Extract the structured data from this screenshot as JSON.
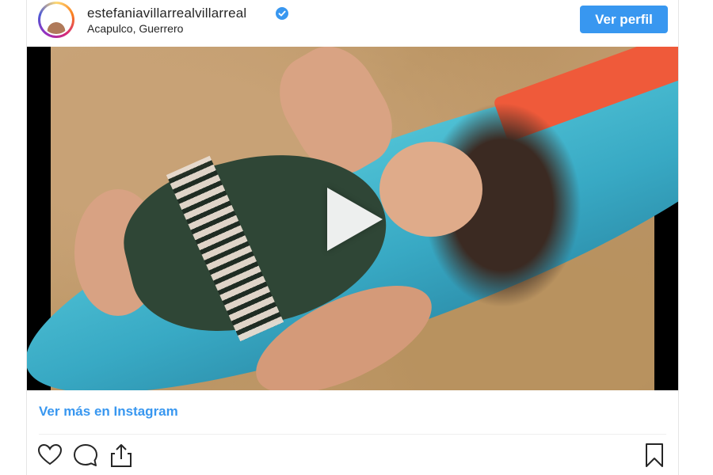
{
  "post": {
    "username": "estefaniavillarrealvillarreal",
    "verified": true,
    "location": "Acapulco, Guerrero",
    "profile_button": "Ver perfil",
    "view_more_link": "Ver más en Instagram"
  },
  "media": {
    "type": "video",
    "play_icon": "play-icon"
  },
  "actions": {
    "icons": [
      "heart-icon",
      "comment-icon",
      "share-icon",
      "bookmark-icon"
    ]
  },
  "colors": {
    "accent": "#3897f0",
    "text": "#262626",
    "divider": "#efefef",
    "video_bg": "#000000"
  }
}
